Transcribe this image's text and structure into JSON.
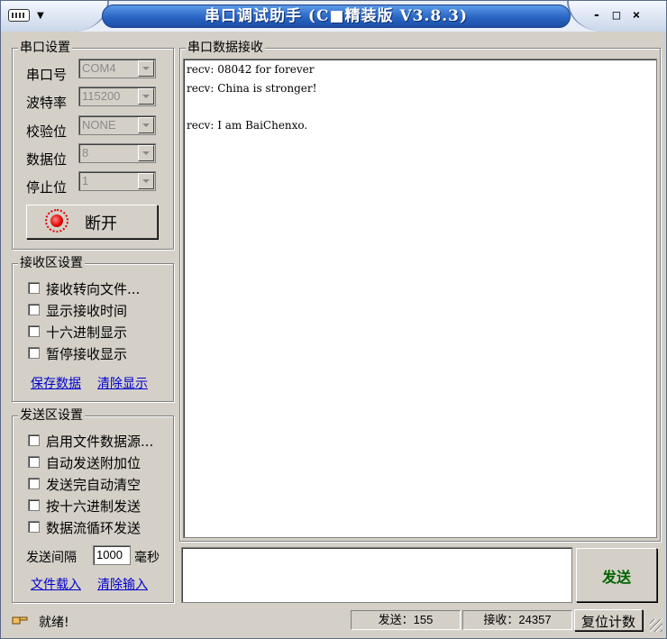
{
  "title": "串口调试助手 (C■精装版 V3.8.3)",
  "window_buttons": {
    "minimize": "-",
    "maximize": "□",
    "close": "×"
  },
  "serial_settings": {
    "title": "串口设置",
    "port": {
      "label": "串口号",
      "value": "COM4"
    },
    "baud": {
      "label": "波特率",
      "value": "115200"
    },
    "parity": {
      "label": "校验位",
      "value": "NONE"
    },
    "databits": {
      "label": "数据位",
      "value": "8"
    },
    "stopbits": {
      "label": "停止位",
      "value": "1"
    },
    "connect_button": "断开"
  },
  "receive_settings": {
    "title": "接收区设置",
    "options": [
      "接收转向文件...",
      "显示接收时间",
      "十六进制显示",
      "暂停接收显示"
    ],
    "save_link": "保存数据",
    "clear_link": "清除显示"
  },
  "send_settings": {
    "title": "发送区设置",
    "options": [
      "启用文件数据源...",
      "自动发送附加位",
      "发送完自动清空",
      "按十六进制发送",
      "数据流循环发送"
    ],
    "interval_label": "发送间隔",
    "interval_value": "1000",
    "interval_unit": "毫秒",
    "load_link": "文件载入",
    "clear_link": "清除输入"
  },
  "receive_panel": {
    "title": "串口数据接收",
    "lines": [
      "recv: 08042 for forever",
      "recv: China is stronger!",
      "",
      "recv: I am BaiChenxo."
    ]
  },
  "send_button": "发送",
  "status": {
    "ready": "就绪!",
    "sent": "发送：155",
    "received": "接收：24357",
    "reset_button": "复位计数"
  },
  "colors": {
    "title_blue": "#2a66c4",
    "send_green": "#006400",
    "led_red": "#e00000",
    "link_blue": "#0000cc"
  }
}
